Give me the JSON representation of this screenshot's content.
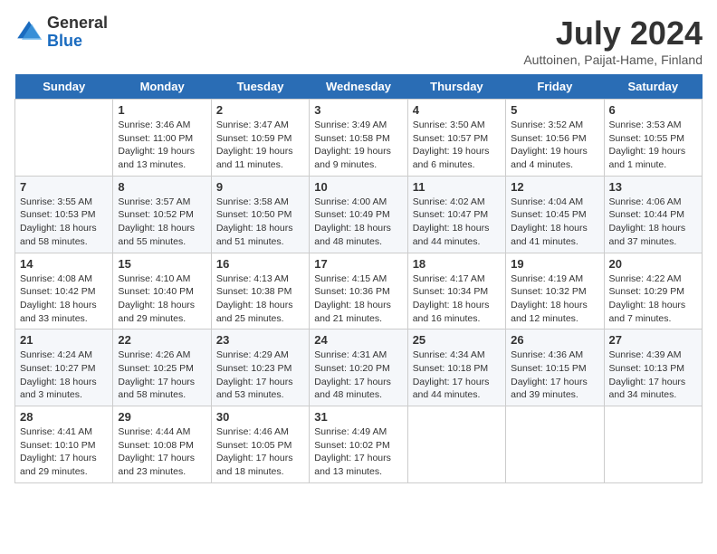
{
  "logo": {
    "general": "General",
    "blue": "Blue"
  },
  "title": "July 2024",
  "subtitle": "Auttoinen, Paijat-Hame, Finland",
  "days": [
    "Sunday",
    "Monday",
    "Tuesday",
    "Wednesday",
    "Thursday",
    "Friday",
    "Saturday"
  ],
  "weeks": [
    [
      {
        "date": "",
        "sunrise": "",
        "sunset": "",
        "daylight": ""
      },
      {
        "date": "1",
        "sunrise": "Sunrise: 3:46 AM",
        "sunset": "Sunset: 11:00 PM",
        "daylight": "Daylight: 19 hours and 13 minutes."
      },
      {
        "date": "2",
        "sunrise": "Sunrise: 3:47 AM",
        "sunset": "Sunset: 10:59 PM",
        "daylight": "Daylight: 19 hours and 11 minutes."
      },
      {
        "date": "3",
        "sunrise": "Sunrise: 3:49 AM",
        "sunset": "Sunset: 10:58 PM",
        "daylight": "Daylight: 19 hours and 9 minutes."
      },
      {
        "date": "4",
        "sunrise": "Sunrise: 3:50 AM",
        "sunset": "Sunset: 10:57 PM",
        "daylight": "Daylight: 19 hours and 6 minutes."
      },
      {
        "date": "5",
        "sunrise": "Sunrise: 3:52 AM",
        "sunset": "Sunset: 10:56 PM",
        "daylight": "Daylight: 19 hours and 4 minutes."
      },
      {
        "date": "6",
        "sunrise": "Sunrise: 3:53 AM",
        "sunset": "Sunset: 10:55 PM",
        "daylight": "Daylight: 19 hours and 1 minute."
      }
    ],
    [
      {
        "date": "7",
        "sunrise": "Sunrise: 3:55 AM",
        "sunset": "Sunset: 10:53 PM",
        "daylight": "Daylight: 18 hours and 58 minutes."
      },
      {
        "date": "8",
        "sunrise": "Sunrise: 3:57 AM",
        "sunset": "Sunset: 10:52 PM",
        "daylight": "Daylight: 18 hours and 55 minutes."
      },
      {
        "date": "9",
        "sunrise": "Sunrise: 3:58 AM",
        "sunset": "Sunset: 10:50 PM",
        "daylight": "Daylight: 18 hours and 51 minutes."
      },
      {
        "date": "10",
        "sunrise": "Sunrise: 4:00 AM",
        "sunset": "Sunset: 10:49 PM",
        "daylight": "Daylight: 18 hours and 48 minutes."
      },
      {
        "date": "11",
        "sunrise": "Sunrise: 4:02 AM",
        "sunset": "Sunset: 10:47 PM",
        "daylight": "Daylight: 18 hours and 44 minutes."
      },
      {
        "date": "12",
        "sunrise": "Sunrise: 4:04 AM",
        "sunset": "Sunset: 10:45 PM",
        "daylight": "Daylight: 18 hours and 41 minutes."
      },
      {
        "date": "13",
        "sunrise": "Sunrise: 4:06 AM",
        "sunset": "Sunset: 10:44 PM",
        "daylight": "Daylight: 18 hours and 37 minutes."
      }
    ],
    [
      {
        "date": "14",
        "sunrise": "Sunrise: 4:08 AM",
        "sunset": "Sunset: 10:42 PM",
        "daylight": "Daylight: 18 hours and 33 minutes."
      },
      {
        "date": "15",
        "sunrise": "Sunrise: 4:10 AM",
        "sunset": "Sunset: 10:40 PM",
        "daylight": "Daylight: 18 hours and 29 minutes."
      },
      {
        "date": "16",
        "sunrise": "Sunrise: 4:13 AM",
        "sunset": "Sunset: 10:38 PM",
        "daylight": "Daylight: 18 hours and 25 minutes."
      },
      {
        "date": "17",
        "sunrise": "Sunrise: 4:15 AM",
        "sunset": "Sunset: 10:36 PM",
        "daylight": "Daylight: 18 hours and 21 minutes."
      },
      {
        "date": "18",
        "sunrise": "Sunrise: 4:17 AM",
        "sunset": "Sunset: 10:34 PM",
        "daylight": "Daylight: 18 hours and 16 minutes."
      },
      {
        "date": "19",
        "sunrise": "Sunrise: 4:19 AM",
        "sunset": "Sunset: 10:32 PM",
        "daylight": "Daylight: 18 hours and 12 minutes."
      },
      {
        "date": "20",
        "sunrise": "Sunrise: 4:22 AM",
        "sunset": "Sunset: 10:29 PM",
        "daylight": "Daylight: 18 hours and 7 minutes."
      }
    ],
    [
      {
        "date": "21",
        "sunrise": "Sunrise: 4:24 AM",
        "sunset": "Sunset: 10:27 PM",
        "daylight": "Daylight: 18 hours and 3 minutes."
      },
      {
        "date": "22",
        "sunrise": "Sunrise: 4:26 AM",
        "sunset": "Sunset: 10:25 PM",
        "daylight": "Daylight: 17 hours and 58 minutes."
      },
      {
        "date": "23",
        "sunrise": "Sunrise: 4:29 AM",
        "sunset": "Sunset: 10:23 PM",
        "daylight": "Daylight: 17 hours and 53 minutes."
      },
      {
        "date": "24",
        "sunrise": "Sunrise: 4:31 AM",
        "sunset": "Sunset: 10:20 PM",
        "daylight": "Daylight: 17 hours and 48 minutes."
      },
      {
        "date": "25",
        "sunrise": "Sunrise: 4:34 AM",
        "sunset": "Sunset: 10:18 PM",
        "daylight": "Daylight: 17 hours and 44 minutes."
      },
      {
        "date": "26",
        "sunrise": "Sunrise: 4:36 AM",
        "sunset": "Sunset: 10:15 PM",
        "daylight": "Daylight: 17 hours and 39 minutes."
      },
      {
        "date": "27",
        "sunrise": "Sunrise: 4:39 AM",
        "sunset": "Sunset: 10:13 PM",
        "daylight": "Daylight: 17 hours and 34 minutes."
      }
    ],
    [
      {
        "date": "28",
        "sunrise": "Sunrise: 4:41 AM",
        "sunset": "Sunset: 10:10 PM",
        "daylight": "Daylight: 17 hours and 29 minutes."
      },
      {
        "date": "29",
        "sunrise": "Sunrise: 4:44 AM",
        "sunset": "Sunset: 10:08 PM",
        "daylight": "Daylight: 17 hours and 23 minutes."
      },
      {
        "date": "30",
        "sunrise": "Sunrise: 4:46 AM",
        "sunset": "Sunset: 10:05 PM",
        "daylight": "Daylight: 17 hours and 18 minutes."
      },
      {
        "date": "31",
        "sunrise": "Sunrise: 4:49 AM",
        "sunset": "Sunset: 10:02 PM",
        "daylight": "Daylight: 17 hours and 13 minutes."
      },
      {
        "date": "",
        "sunrise": "",
        "sunset": "",
        "daylight": ""
      },
      {
        "date": "",
        "sunrise": "",
        "sunset": "",
        "daylight": ""
      },
      {
        "date": "",
        "sunrise": "",
        "sunset": "",
        "daylight": ""
      }
    ]
  ]
}
